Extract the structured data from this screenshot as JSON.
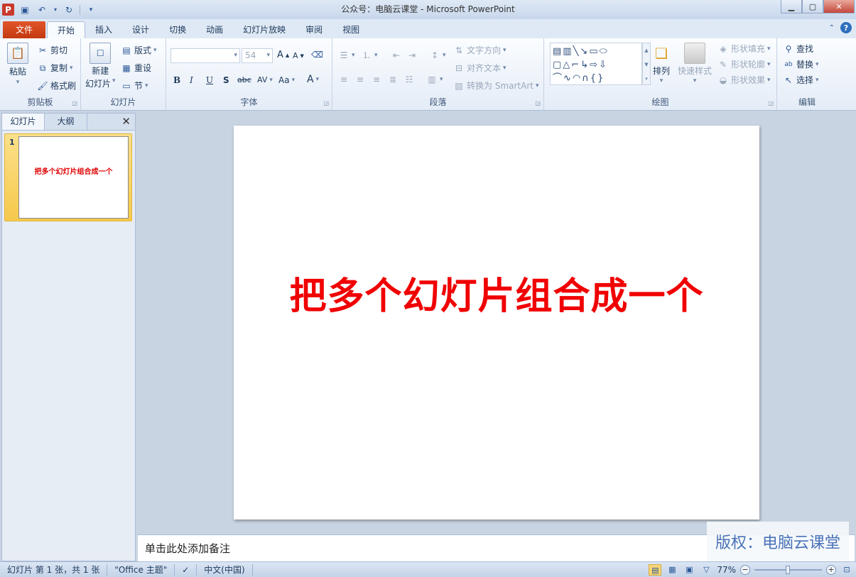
{
  "window": {
    "title": "公众号：电脑云课堂 - Microsoft PowerPoint",
    "app_icon": "P"
  },
  "qat": {
    "save_icon": "save-icon",
    "undo_icon": "undo-icon",
    "redo_icon": "redo-icon"
  },
  "tabs": [
    {
      "label": "文件"
    },
    {
      "label": "开始"
    },
    {
      "label": "插入"
    },
    {
      "label": "设计"
    },
    {
      "label": "切换"
    },
    {
      "label": "动画"
    },
    {
      "label": "幻灯片放映"
    },
    {
      "label": "审阅"
    },
    {
      "label": "视图"
    }
  ],
  "ribbon": {
    "clipboard": {
      "paste": "粘贴",
      "cut": "剪切",
      "copy": "复制",
      "format_painter": "格式刷",
      "label": "剪贴板"
    },
    "slides": {
      "new_slide_1": "新建",
      "new_slide_2": "幻灯片",
      "layout": "版式",
      "reset": "重设",
      "section": "节",
      "label": "幻灯片"
    },
    "font": {
      "font_size": "54",
      "bold": "B",
      "italic": "I",
      "underline": "U",
      "shadow": "S",
      "strike": "abc",
      "spacing": "AV",
      "case": "Aa",
      "color": "A",
      "grow": "A",
      "shrink": "A",
      "label": "字体"
    },
    "paragraph": {
      "text_direction": "文字方向",
      "align_text": "对齐文本",
      "smartart": "转换为 SmartArt",
      "label": "段落"
    },
    "drawing": {
      "arrange": "排列",
      "quick_styles": "快速样式",
      "shape_fill": "形状填充",
      "shape_outline": "形状轮廓",
      "shape_effects": "形状效果",
      "label": "绘图"
    },
    "editing": {
      "find": "查找",
      "replace": "替换",
      "select": "选择",
      "label": "编辑"
    }
  },
  "left_pane": {
    "tab_slides": "幻灯片",
    "tab_outline": "大纲",
    "close": "✕",
    "thumb_number": "1",
    "thumb_text": "把多个幻灯片组合成一个"
  },
  "slide": {
    "title": "把多个幻灯片组合成一个"
  },
  "notes": {
    "placeholder": "单击此处添加备注"
  },
  "watermark": "版权：电脑云课堂",
  "status": {
    "slide_info": "幻灯片 第 1 张，共 1 张",
    "theme": "\"Office 主题\"",
    "language": "中文(中国)",
    "zoom": "77%"
  }
}
